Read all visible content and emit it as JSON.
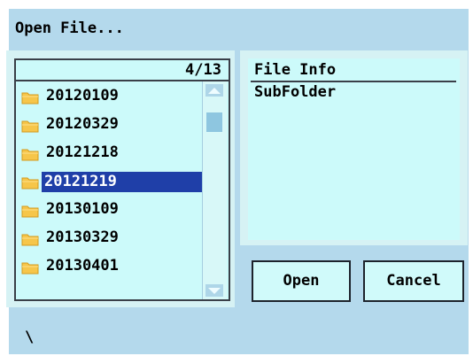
{
  "dialog": {
    "title": "Open File..."
  },
  "list": {
    "counter": "4/13",
    "items": [
      {
        "label": "20120109",
        "selected": false
      },
      {
        "label": "20120329",
        "selected": false
      },
      {
        "label": "20121218",
        "selected": false
      },
      {
        "label": "20121219",
        "selected": true
      },
      {
        "label": "20130109",
        "selected": false
      },
      {
        "label": "20130329",
        "selected": false
      },
      {
        "label": "20130401",
        "selected": false
      }
    ],
    "item_icon": "folder-icon"
  },
  "info": {
    "header": "File Info",
    "value": "SubFolder"
  },
  "buttons": {
    "open_label": "Open",
    "cancel_label": "Cancel"
  },
  "path": "\\",
  "colors": {
    "background": "#b4d9ec",
    "panel": "#ccfafa",
    "selection": "#1f3fa8",
    "folder": "#f6c64a"
  }
}
